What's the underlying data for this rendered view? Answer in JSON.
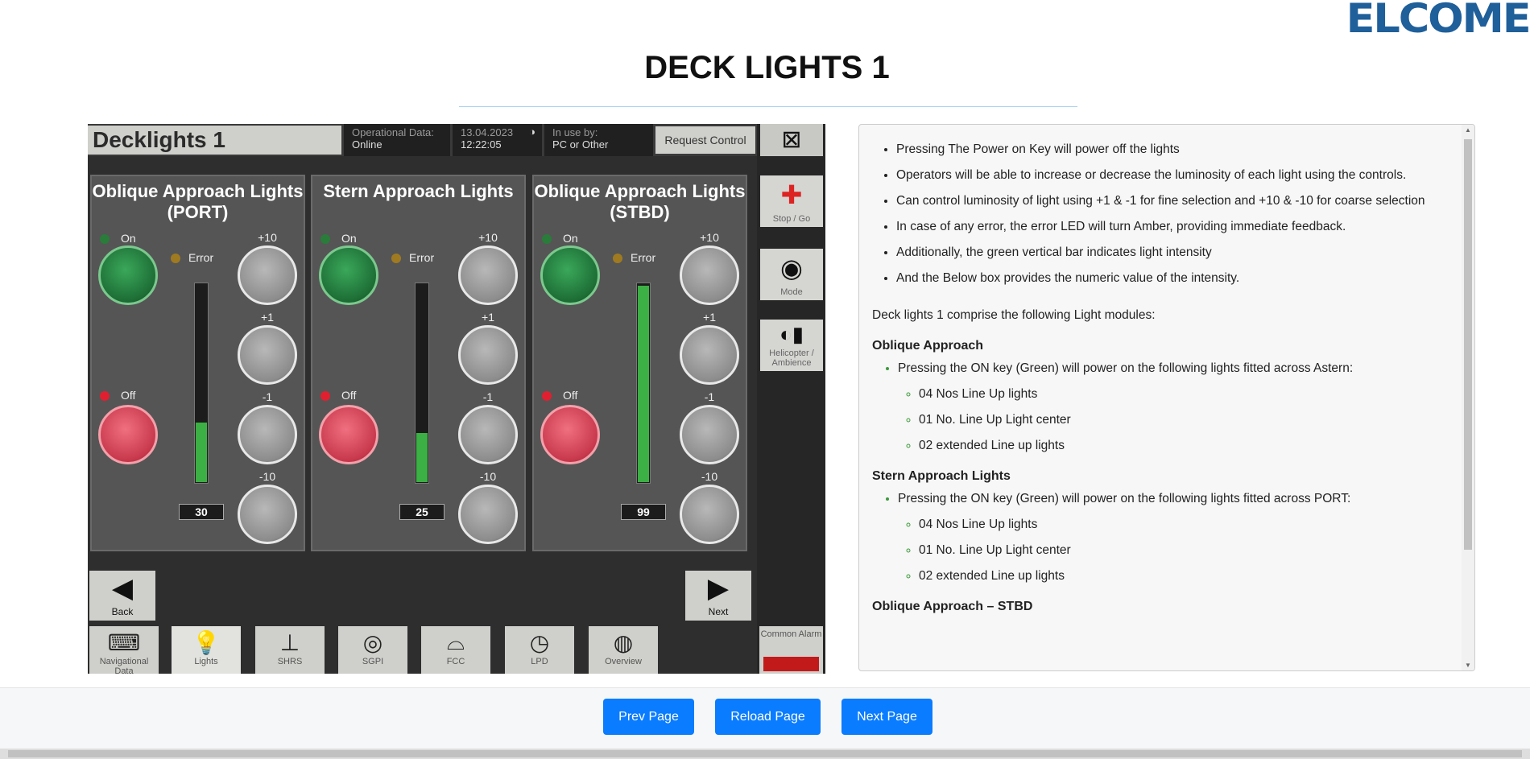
{
  "logo": "ELCOME",
  "page_title": "DECK LIGHTS 1",
  "hmi": {
    "title": "Decklights 1",
    "op_label": "Operational Data:",
    "op_value": "Online",
    "date": "13.04.2023",
    "time": "12:22:05",
    "inuse_label": "In use by:",
    "inuse_value": "PC or Other",
    "request_control": "Request Control",
    "side": {
      "stop_go": "Stop / Go",
      "mode": "Mode",
      "heli": "Helicopter / Ambience"
    },
    "panels": [
      {
        "title": "Oblique Approach Lights (PORT)",
        "on": "On",
        "off": "Off",
        "error": "Error",
        "value": "30",
        "level": 0.3
      },
      {
        "title": "Stern Approach Lights",
        "on": "On",
        "off": "Off",
        "error": "Error",
        "value": "25",
        "level": 0.25
      },
      {
        "title": "Oblique Approach Lights (STBD)",
        "on": "On",
        "off": "Off",
        "error": "Error",
        "value": "99",
        "level": 0.99
      }
    ],
    "step_labels": [
      "+10",
      "+1",
      "-1",
      "-10"
    ],
    "back": "Back",
    "next": "Next",
    "bottom": [
      "Navigational Data",
      "Lights",
      "SHRS",
      "SGPI",
      "FCC",
      "LPD",
      "Overview"
    ],
    "common_alarm": "Common Alarm"
  },
  "info": {
    "bullets": [
      "Pressing The Power on Key will power off the lights",
      "Operators will be able to increase or decrease the luminosity of each light using the controls.",
      "Can control luminosity of light using +1 & -1 for fine selection and +10 & -10 for coarse selection",
      "In case of any error, the error LED will turn Amber, providing immediate feedback.",
      "Additionally, the green vertical bar indicates light intensity",
      "And the Below box provides the numeric value of the intensity."
    ],
    "intro": "Deck lights 1 comprise the following Light modules:",
    "sec1": {
      "heading": "Oblique Approach",
      "point": "Pressing the ON key (Green) will power on the following lights fitted across Astern:",
      "items": [
        "04 Nos Line Up lights",
        "01 No. Line Up Light center",
        "02 extended Line up lights"
      ]
    },
    "sec2": {
      "heading": "Stern Approach Lights",
      "point": "Pressing the ON key (Green) will power on the following lights fitted across PORT:",
      "items": [
        "04 Nos Line Up lights",
        "01 No. Line Up Light center",
        "02 extended Line up lights"
      ]
    },
    "sec3": {
      "heading": "Oblique Approach – STBD"
    }
  },
  "footer": {
    "prev": "Prev Page",
    "reload": "Reload Page",
    "next": "Next Page"
  }
}
